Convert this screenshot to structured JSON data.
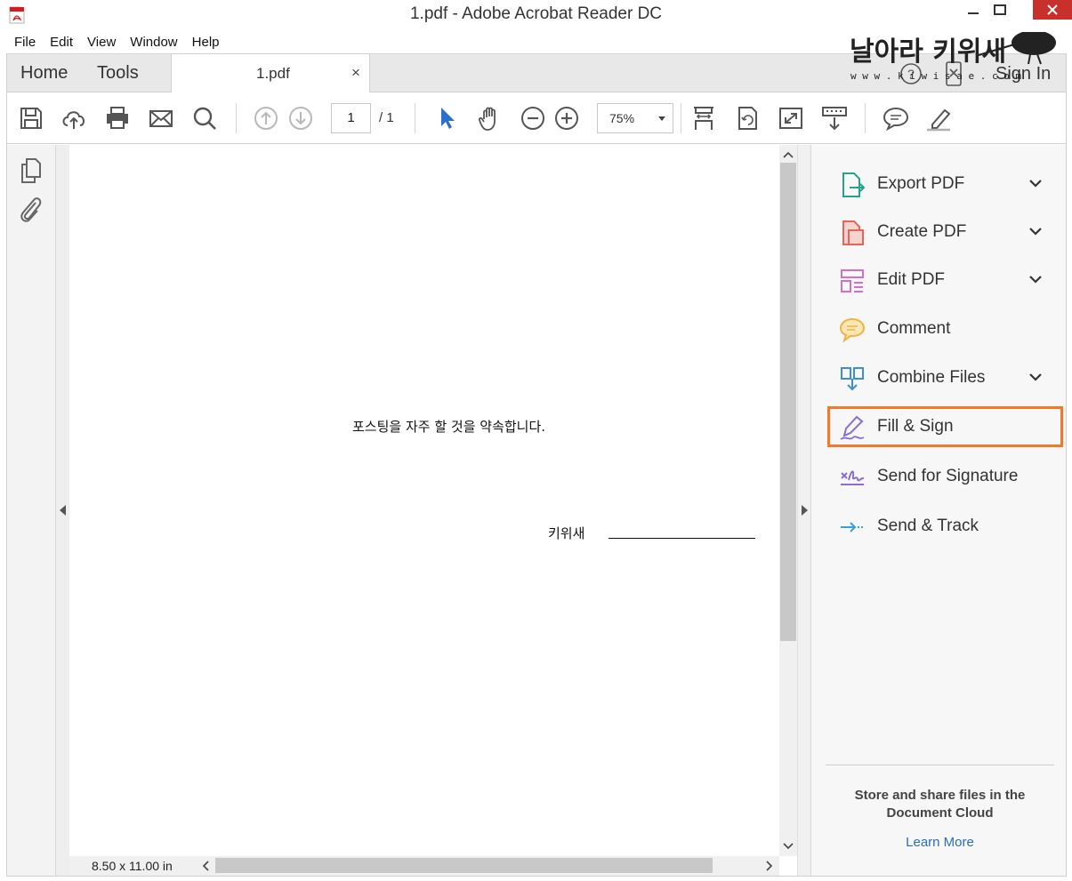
{
  "window": {
    "title": "1.pdf - Adobe Acrobat Reader DC"
  },
  "menu": [
    "File",
    "Edit",
    "View",
    "Window",
    "Help"
  ],
  "tabs": {
    "home": "Home",
    "tools": "Tools",
    "document": "1.pdf",
    "close_glyph": "×",
    "sign_in": "Sign In"
  },
  "watermark": {
    "text": "날아라 키위새",
    "url": "w w w . k i w i s a e . c o m"
  },
  "toolbar": {
    "page_current": "1",
    "page_total": "/ 1",
    "zoom": "75%"
  },
  "document": {
    "main_text": "포스팅을 자주 할 것을 약속합니다.",
    "signature_label": "키위새"
  },
  "status": {
    "page_size": "8.50 x 11.00 in"
  },
  "right_pane": {
    "items": [
      {
        "label": "Export PDF",
        "icon": "export-pdf-icon",
        "expandable": true,
        "color": "#26a38f"
      },
      {
        "label": "Create PDF",
        "icon": "create-pdf-icon",
        "expandable": true,
        "color": "#e5645b"
      },
      {
        "label": "Edit PDF",
        "icon": "edit-pdf-icon",
        "expandable": true,
        "color": "#d36fc8"
      },
      {
        "label": "Comment",
        "icon": "comment-icon",
        "expandable": false,
        "color": "#f2b33d"
      },
      {
        "label": "Combine Files",
        "icon": "combine-files-icon",
        "expandable": true,
        "color": "#3d8fd4"
      },
      {
        "label": "Fill & Sign",
        "icon": "fill-sign-icon",
        "expandable": false,
        "color": "#8a6fd1"
      },
      {
        "label": "Send for Signature",
        "icon": "send-signature-icon",
        "expandable": false,
        "color": "#8a6fd1"
      },
      {
        "label": "Send & Track",
        "icon": "send-track-icon",
        "expandable": false,
        "color": "#3d9fd4"
      }
    ],
    "highlight_color": "#ef7a2a",
    "cloud_message": "Store and share files in the Document Cloud",
    "learn_more": "Learn More"
  }
}
